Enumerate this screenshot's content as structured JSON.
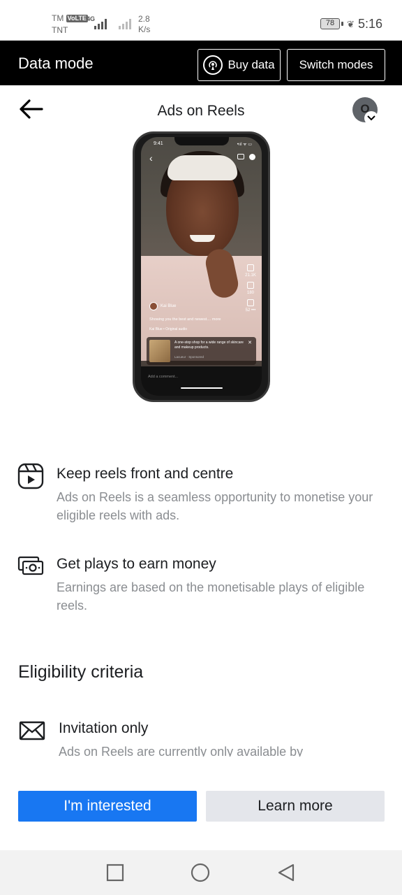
{
  "status_bar": {
    "carrier_top": "TM",
    "volte": "VoLTE",
    "carrier_bottom": "TNT",
    "network": "4G",
    "speed_value": "2.8",
    "speed_unit": "K/s",
    "battery": "78",
    "time": "5:16"
  },
  "data_bar": {
    "title": "Data mode",
    "buy_label": "Buy data",
    "switch_label": "Switch modes"
  },
  "header": {
    "title": "Ads on Reels",
    "avatar_letter": "O"
  },
  "phone_preview": {
    "time": "9:41",
    "status": "•ııl ᯤ ▭",
    "likes": "21.1K",
    "comments": "180",
    "shares": "52",
    "username": "Kai Blue",
    "caption": "Showing you the best and newest.... more",
    "audio": "Kai Blue • Original audio",
    "ad_text": "A one-stop shop for a wide range of skincare and makeup products.",
    "ad_sponsor": "Lacueur · Sponsored",
    "comment_placeholder": "Add a comment..."
  },
  "features": [
    {
      "icon": "reels-icon",
      "title": "Keep reels front and centre",
      "description": "Ads on Reels is a seamless opportunity to monetise your eligible reels with ads."
    },
    {
      "icon": "money-icon",
      "title": "Get plays to earn money",
      "description": "Earnings are based on the monetisable plays of eligible reels."
    }
  ],
  "eligibility": {
    "title": "Eligibility criteria",
    "items": [
      {
        "icon": "envelope-icon",
        "title": "Invitation only",
        "description": "Ads on Reels are currently only available by"
      }
    ]
  },
  "actions": {
    "primary": "I'm interested",
    "secondary": "Learn more"
  },
  "colors": {
    "primary": "#1877f2",
    "secondary_bg": "#e4e6eb",
    "data_bar_bg": "#000000"
  }
}
